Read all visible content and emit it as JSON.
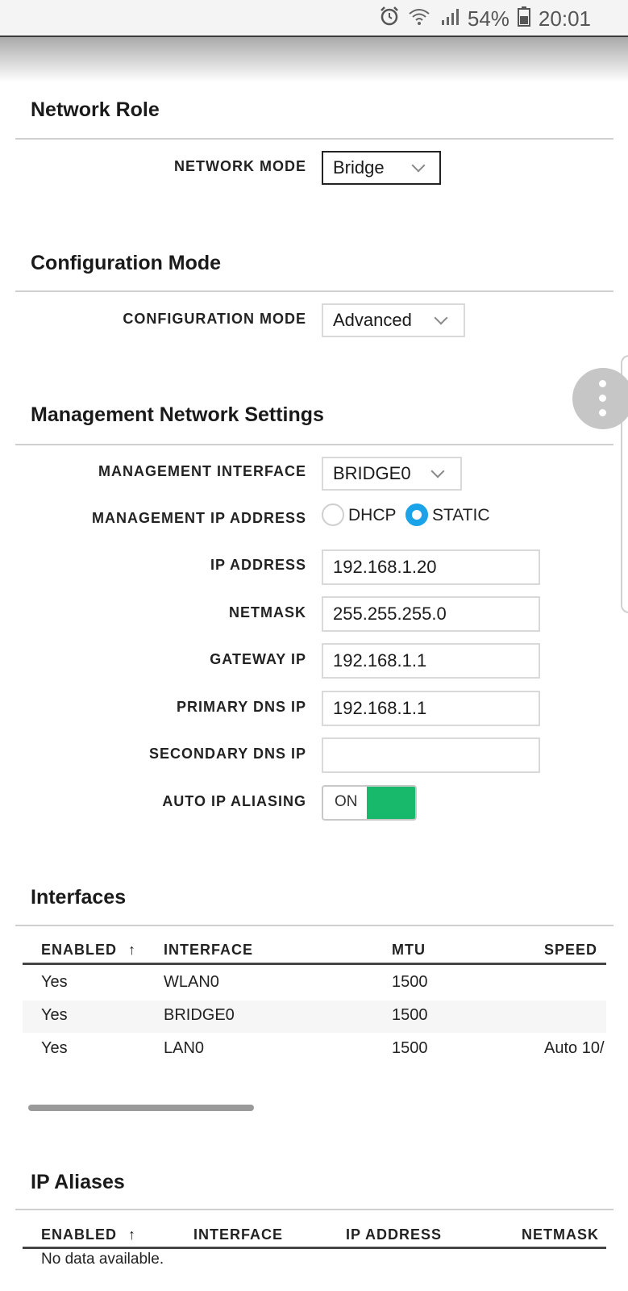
{
  "status_bar": {
    "icons": [
      "alarm-icon",
      "wifi-icon",
      "signal-icon"
    ],
    "battery": "54%",
    "time": "20:01"
  },
  "network_role": {
    "title": "Network Role",
    "network_mode_label": "NETWORK MODE",
    "network_mode_value": "Bridge"
  },
  "configuration_mode": {
    "title": "Configuration Mode",
    "label": "CONFIGURATION MODE",
    "value": "Advanced"
  },
  "management": {
    "title": "Management Network Settings",
    "interface_label": "MANAGEMENT INTERFACE",
    "interface_value": "BRIDGE0",
    "ip_mode_label": "MANAGEMENT IP ADDRESS",
    "dhcp_label": "DHCP",
    "static_label": "STATIC",
    "selected_ip_mode": "STATIC",
    "ip_address_label": "IP ADDRESS",
    "ip_address_value": "192.168.1.20",
    "netmask_label": "NETMASK",
    "netmask_value": "255.255.255.0",
    "gateway_label": "GATEWAY IP",
    "gateway_value": "192.168.1.1",
    "primary_dns_label": "PRIMARY DNS IP",
    "primary_dns_value": "192.168.1.1",
    "secondary_dns_label": "SECONDARY DNS IP",
    "secondary_dns_value": "",
    "auto_ip_label": "AUTO IP ALIASING",
    "auto_ip_value": "ON"
  },
  "interfaces": {
    "title": "Interfaces",
    "columns": [
      "ENABLED",
      "INTERFACE",
      "MTU",
      "SPEED"
    ],
    "sort_indicator": "↑",
    "rows": [
      [
        "Yes",
        "WLAN0",
        "1500",
        ""
      ],
      [
        "Yes",
        "BRIDGE0",
        "1500",
        ""
      ],
      [
        "Yes",
        "LAN0",
        "1500",
        "Auto 10/"
      ]
    ]
  },
  "ip_aliases": {
    "title": "IP Aliases",
    "columns": [
      "ENABLED",
      "INTERFACE",
      "IP ADDRESS",
      "NETMASK"
    ],
    "sort_indicator": "↑",
    "empty_text": "No data available."
  },
  "colors": {
    "accent_radio": "#1aa3e8",
    "toggle_on": "#18b96a"
  }
}
